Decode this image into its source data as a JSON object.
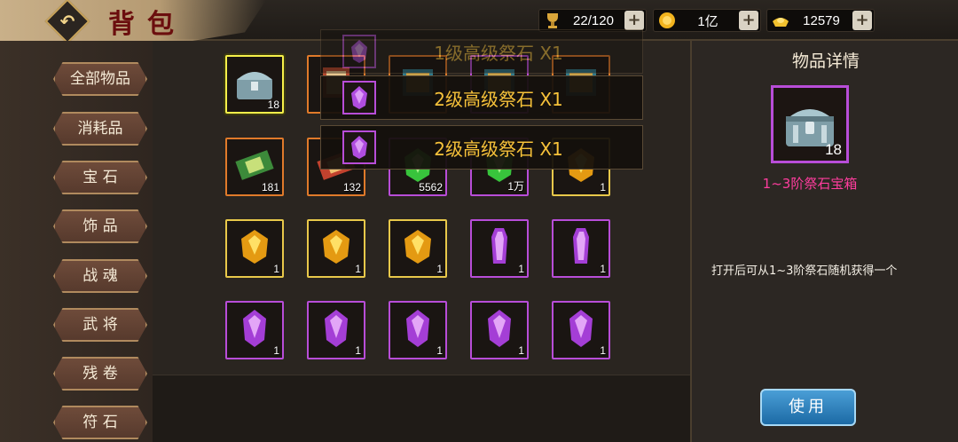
{
  "header": {
    "title": "背包",
    "resources": [
      {
        "icon": "trophy-icon",
        "value": "22/120"
      },
      {
        "icon": "gold-coin-icon",
        "value": "1亿"
      },
      {
        "icon": "ingot-icon",
        "value": "12579"
      }
    ]
  },
  "nav": {
    "items": [
      {
        "label": "全部物品"
      },
      {
        "label": "消耗品"
      },
      {
        "label": "宝 石"
      },
      {
        "label": "饰 品"
      },
      {
        "label": "战 魂"
      },
      {
        "label": "武 将"
      },
      {
        "label": "残 卷"
      },
      {
        "label": "符 石"
      }
    ]
  },
  "grid": {
    "slots": [
      {
        "row": 0,
        "col": 0,
        "count": "18",
        "rarity": "selected",
        "icon": "treasure-chest-icon"
      },
      {
        "row": 0,
        "col": 1,
        "count": "",
        "rarity": "orange",
        "icon": "scroll-icon"
      },
      {
        "row": 0,
        "col": 2,
        "count": "",
        "rarity": "orange",
        "icon": "book-icon"
      },
      {
        "row": 0,
        "col": 3,
        "count": "",
        "rarity": "purple",
        "icon": "book-icon"
      },
      {
        "row": 0,
        "col": 4,
        "count": "",
        "rarity": "orange",
        "icon": "book-icon"
      },
      {
        "row": 1,
        "col": 0,
        "count": "181",
        "rarity": "orange",
        "icon": "green-scroll-icon"
      },
      {
        "row": 1,
        "col": 1,
        "count": "132",
        "rarity": "orange",
        "icon": "red-scroll-icon"
      },
      {
        "row": 1,
        "col": 2,
        "count": "5562",
        "rarity": "purple",
        "icon": "green-gem-icon"
      },
      {
        "row": 1,
        "col": 3,
        "count": "1万",
        "rarity": "purple",
        "icon": "green-gem-icon"
      },
      {
        "row": 1,
        "col": 4,
        "count": "1",
        "rarity": "gold",
        "icon": "yellow-gem-icon"
      },
      {
        "row": 2,
        "col": 0,
        "count": "1",
        "rarity": "gold",
        "icon": "yellow-gem-icon"
      },
      {
        "row": 2,
        "col": 1,
        "count": "1",
        "rarity": "gold",
        "icon": "yellow-gem-icon"
      },
      {
        "row": 2,
        "col": 2,
        "count": "1",
        "rarity": "gold",
        "icon": "yellow-gem-icon"
      },
      {
        "row": 2,
        "col": 3,
        "count": "1",
        "rarity": "purple",
        "icon": "purple-crystal-icon"
      },
      {
        "row": 2,
        "col": 4,
        "count": "1",
        "rarity": "purple",
        "icon": "purple-crystal-icon"
      },
      {
        "row": 3,
        "col": 0,
        "count": "1",
        "rarity": "purple",
        "icon": "purple-gem-icon"
      },
      {
        "row": 3,
        "col": 1,
        "count": "1",
        "rarity": "purple",
        "icon": "purple-gem-icon"
      },
      {
        "row": 3,
        "col": 2,
        "count": "1",
        "rarity": "purple",
        "icon": "purple-gem-icon"
      },
      {
        "row": 3,
        "col": 3,
        "count": "1",
        "rarity": "purple",
        "icon": "purple-gem-icon"
      },
      {
        "row": 3,
        "col": 4,
        "count": "1",
        "rarity": "purple",
        "icon": "purple-gem-icon"
      }
    ]
  },
  "toasts": [
    {
      "text": "1级高级祭石 X1",
      "faded": true
    },
    {
      "text": "2级高级祭石 X1",
      "faded": false
    },
    {
      "text": "2级高级祭石 X1",
      "faded": false
    }
  ],
  "detail": {
    "title": "物品详情",
    "count": "18",
    "name": "1~3阶祭石宝箱",
    "description": "打开后可从1~3阶祭石随机获得一个",
    "use_label": "使用"
  },
  "colors": {
    "gold": "#e8c84a",
    "purple": "#b84dd8",
    "orange": "#e07a2a",
    "name_pink": "#ff3d9e",
    "toast_text": "#f7c23a"
  }
}
